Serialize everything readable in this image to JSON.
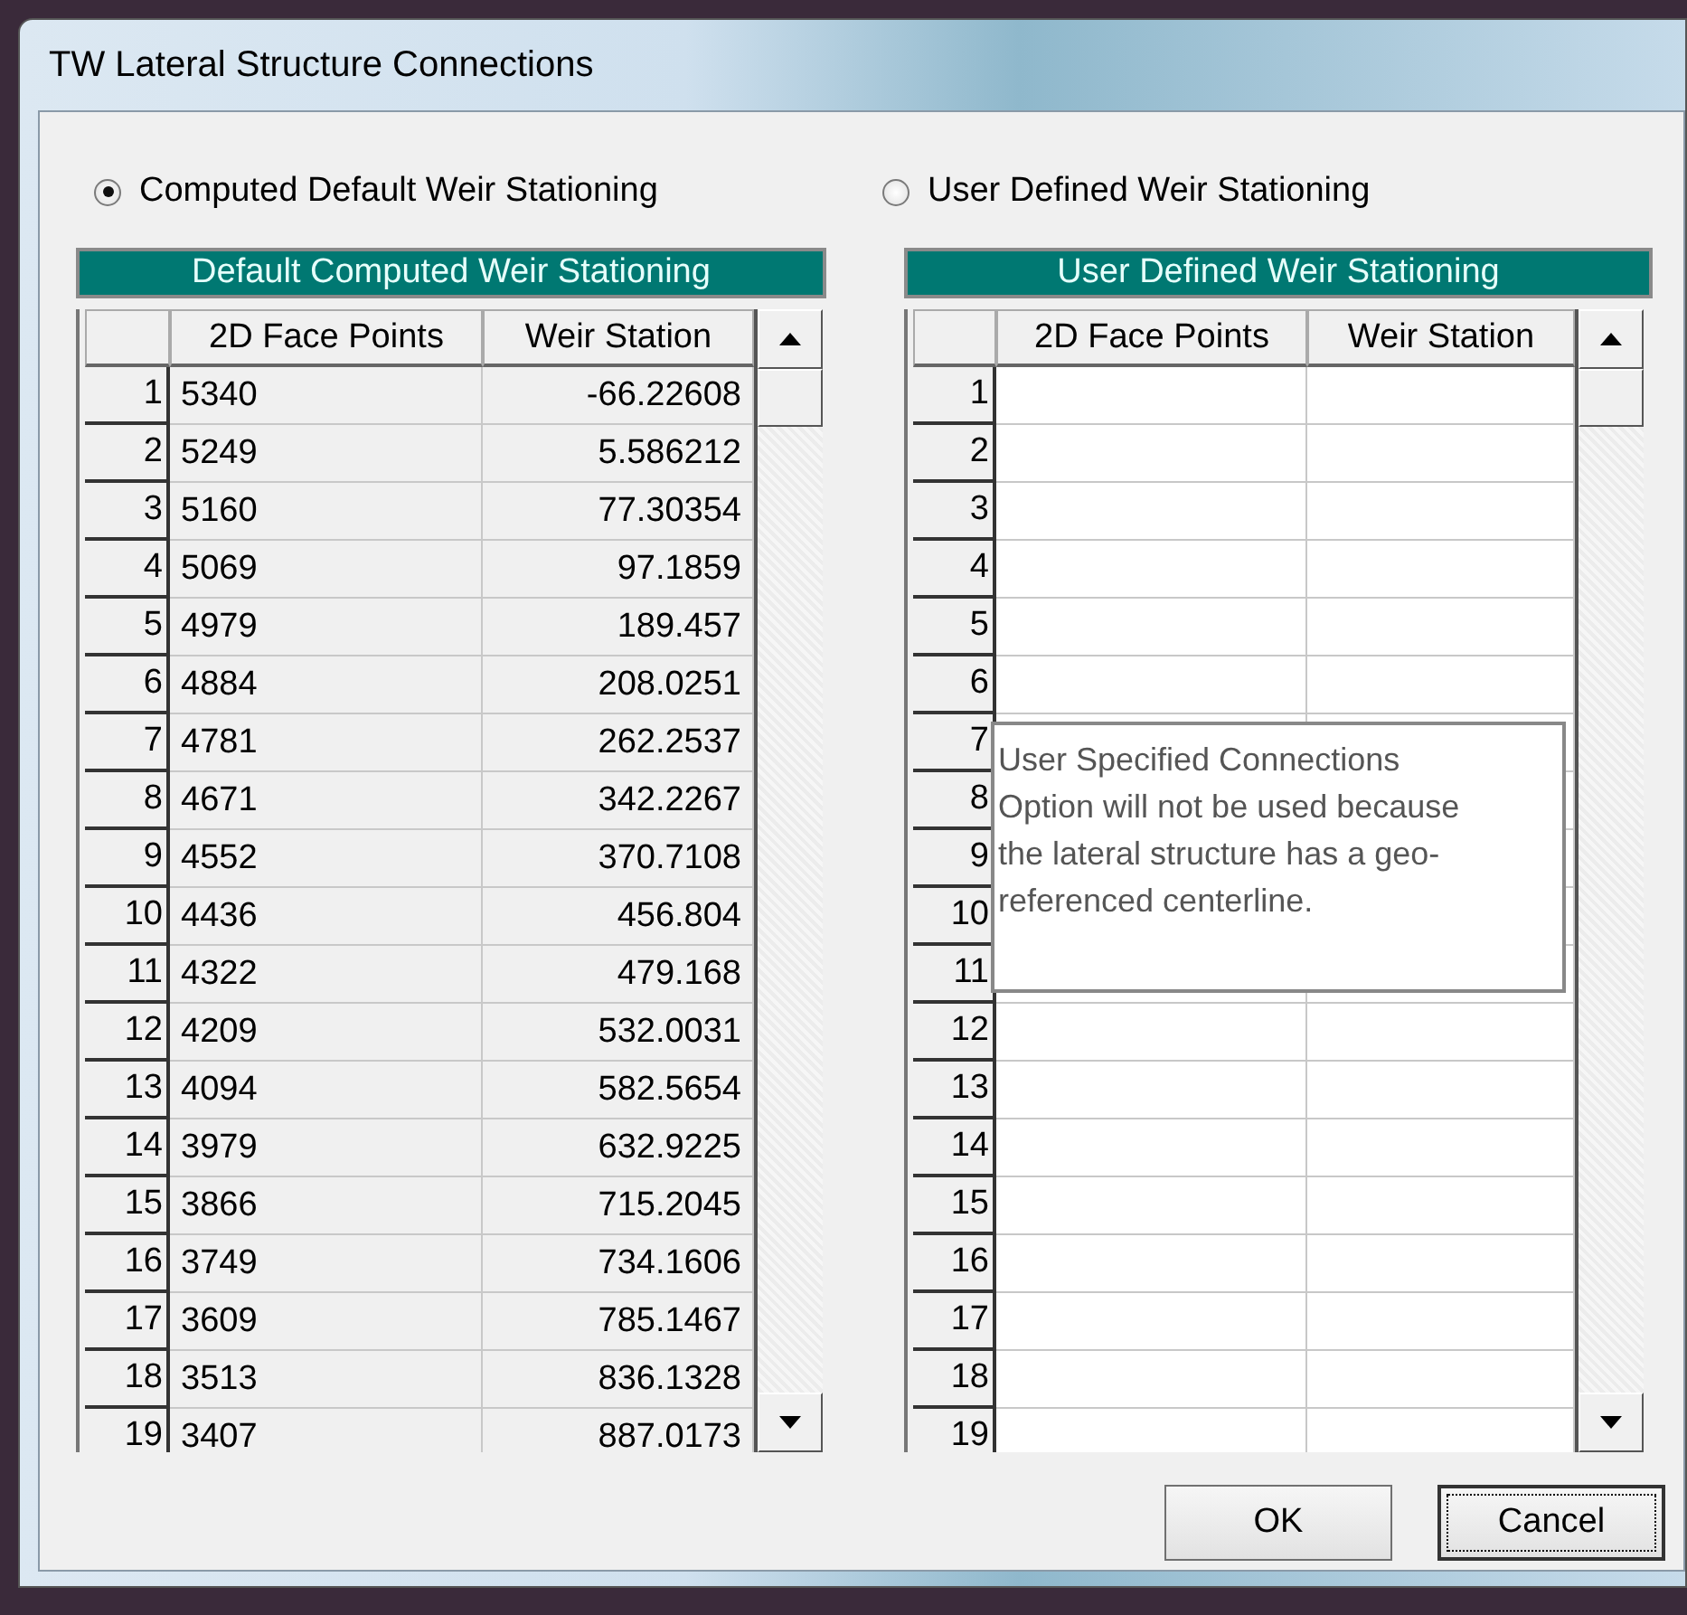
{
  "window": {
    "title": "TW Lateral Structure Connections"
  },
  "options": [
    {
      "label": "Computed Default Weir Stationing",
      "selected": true
    },
    {
      "label": "User Defined Weir Stationing",
      "selected": false
    }
  ],
  "grids": [
    {
      "title": "Default Computed Weir Stationing",
      "read_only": true,
      "columns": [
        "2D Face Points",
        "Weir Station"
      ],
      "rows": [
        {
          "number": "1",
          "cells": [
            "5340",
            "-66.22608"
          ]
        },
        {
          "number": "2",
          "cells": [
            "5249",
            "5.586212"
          ]
        },
        {
          "number": "3",
          "cells": [
            "5160",
            "77.30354"
          ]
        },
        {
          "number": "4",
          "cells": [
            "5069",
            "97.1859"
          ]
        },
        {
          "number": "5",
          "cells": [
            "4979",
            "189.457"
          ]
        },
        {
          "number": "6",
          "cells": [
            "4884",
            "208.0251"
          ]
        },
        {
          "number": "7",
          "cells": [
            "4781",
            "262.2537"
          ]
        },
        {
          "number": "8",
          "cells": [
            "4671",
            "342.2267"
          ]
        },
        {
          "number": "9",
          "cells": [
            "4552",
            "370.7108"
          ]
        },
        {
          "number": "10",
          "cells": [
            "4436",
            "456.804"
          ]
        },
        {
          "number": "11",
          "cells": [
            "4322",
            "479.168"
          ]
        },
        {
          "number": "12",
          "cells": [
            "4209",
            "532.0031"
          ]
        },
        {
          "number": "13",
          "cells": [
            "4094",
            "582.5654"
          ]
        },
        {
          "number": "14",
          "cells": [
            "3979",
            "632.9225"
          ]
        },
        {
          "number": "15",
          "cells": [
            "3866",
            "715.2045"
          ]
        },
        {
          "number": "16",
          "cells": [
            "3749",
            "734.1606"
          ]
        },
        {
          "number": "17",
          "cells": [
            "3609",
            "785.1467"
          ]
        },
        {
          "number": "18",
          "cells": [
            "3513",
            "836.1328"
          ]
        },
        {
          "number": "19",
          "cells": [
            "3407",
            "887.0173"
          ]
        }
      ]
    },
    {
      "title": "User Defined Weir Stationing",
      "read_only": false,
      "columns": [
        "2D Face Points",
        "Weir Station"
      ],
      "rows": [
        {
          "number": "1"
        },
        {
          "number": "2"
        },
        {
          "number": "3"
        },
        {
          "number": "4"
        },
        {
          "number": "5"
        },
        {
          "number": "6"
        },
        {
          "number": "7"
        },
        {
          "number": "8"
        },
        {
          "number": "9"
        },
        {
          "number": "10"
        },
        {
          "number": "11"
        },
        {
          "number": "12"
        },
        {
          "number": "13"
        },
        {
          "number": "14"
        },
        {
          "number": "15"
        },
        {
          "number": "16"
        },
        {
          "number": "17"
        },
        {
          "number": "18"
        },
        {
          "number": "19"
        }
      ],
      "tooltip": {
        "text": "User Specified Connections Option will not be used because the lateral structure has a geo-referenced centerline."
      }
    }
  ],
  "buttons": [
    {
      "label": "OK",
      "focused": false
    },
    {
      "label": "Cancel",
      "focused": true
    }
  ]
}
